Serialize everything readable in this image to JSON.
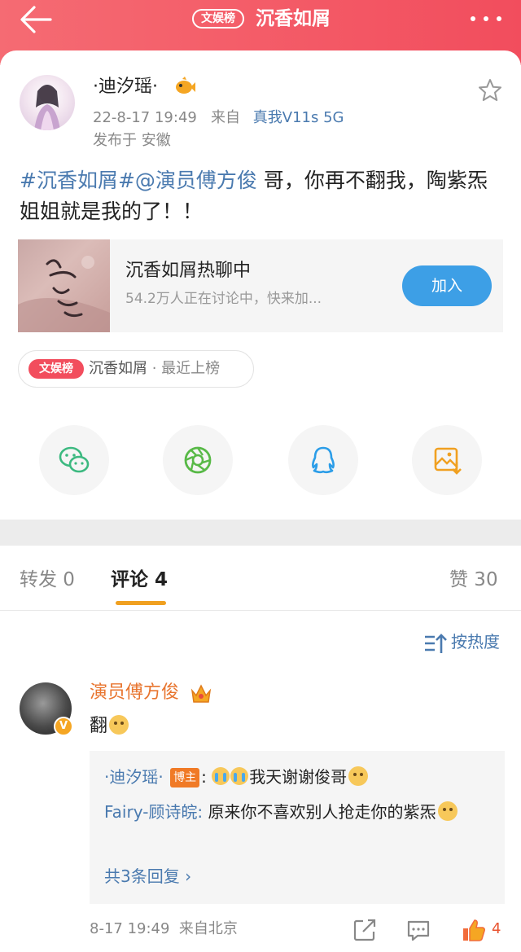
{
  "header": {
    "back_icon": "back-arrow-icon",
    "tag": "文娱榜",
    "title": "沉香如屑",
    "more_icon": "more-dots-icon",
    "bg_colors": [
      "#f56b73",
      "#f24d5d"
    ]
  },
  "post": {
    "author": "·迪汐瑶·",
    "date": "22-8-17 19:49",
    "from_label": "来自",
    "device": "真我V11s 5G",
    "location": "发布于 安徽",
    "text_tag": "#沉香如屑#@演员傅方俊",
    "text_body": " 哥，你再不翻我，陶紫炁姐姐就是我的了！！",
    "topic": {
      "name": "沉香如屑热聊中",
      "subtitle": "54.2万人正在讨论中，快来加...",
      "join_label": "加入"
    },
    "rank": {
      "badge": "文娱榜",
      "name": "沉香如屑",
      "status": " · 最近上榜"
    }
  },
  "share_icons": [
    "wechat-icon",
    "moments-icon",
    "qq-icon",
    "save-image-icon"
  ],
  "tabs": {
    "repost": "转发 0",
    "comments": "评论 4",
    "likes": "赞 30",
    "accent": "#f0a020"
  },
  "sort_label": "按热度",
  "comment": {
    "author": "演员傅方俊",
    "text": "翻",
    "reply1_name": "·迪汐瑶·",
    "reply1_badge": "博主",
    "reply1_sep": ":",
    "reply1_text": "我天谢谢俊哥",
    "reply2_name": "Fairy-顾诗皖:",
    "reply2_text": " 原来你不喜欢别人抢走你的紫炁",
    "more_replies": "共3条回复 ›",
    "time": "8-17 19:49",
    "location": "来自北京",
    "like_count": "4"
  },
  "colors": {
    "link": "#4a7aaf",
    "name_orange": "#e8752f",
    "join_blue": "#3d9fe6"
  }
}
